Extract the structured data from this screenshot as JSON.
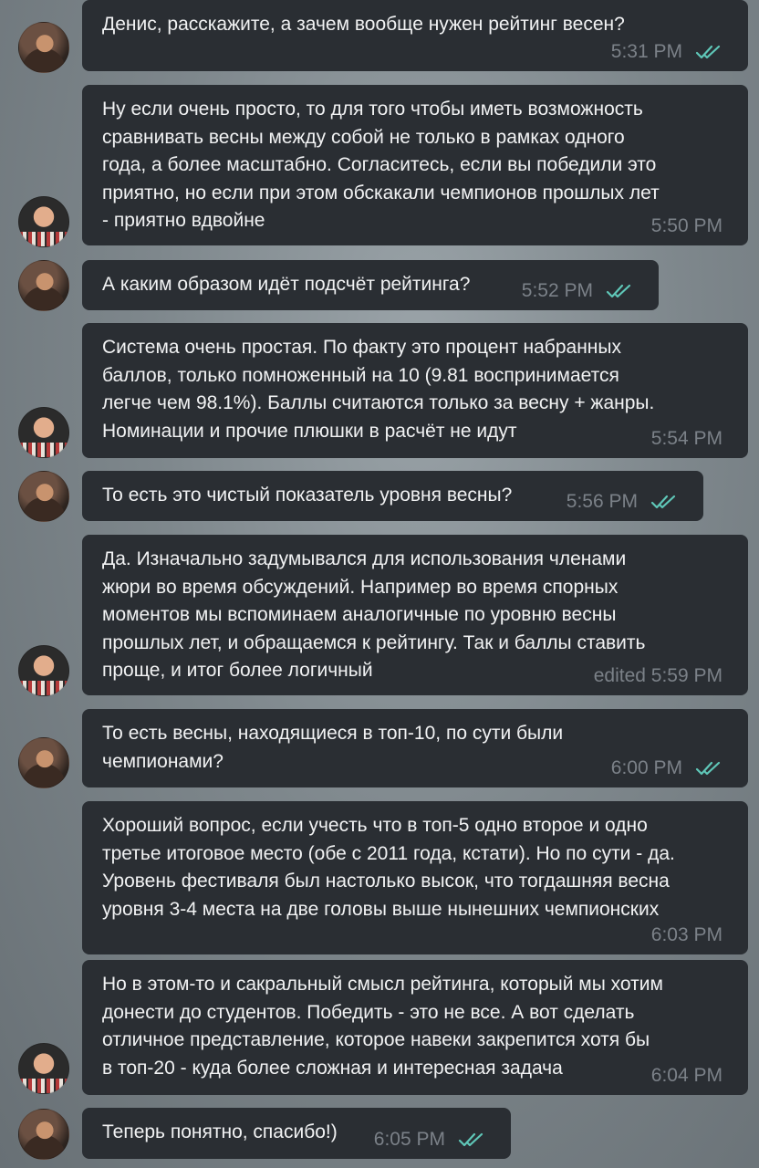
{
  "messages": [
    {
      "sender": "asker",
      "text": "Денис, расскажите, а зачем вообще нужен рейтинг весен?",
      "time": "5:31 PM",
      "read_icon": "double-check-icon"
    },
    {
      "sender": "denis",
      "text": "Ну если очень просто, то для того чтобы иметь возможность\nсравнивать весны между собой не только в рамках одного\nгода, а более масштабно. Согласитесь, если вы победили это\nприятно, но если при этом обскакали чемпионов прошлых лет\n- приятно вдвойне",
      "time": "5:50 PM"
    },
    {
      "sender": "asker",
      "text": "А каким образом идёт подсчёт рейтинга?",
      "time": "5:52 PM",
      "read_icon": "double-check-icon"
    },
    {
      "sender": "denis",
      "text": "Система очень простая. По факту это процент набранных\nбаллов, только помноженный на 10 (9.81 воспринимается\nлегче чем 98.1%). Баллы считаются только за весну + жанры.\nНоминации и прочие плюшки в расчёт не идут",
      "time": "5:54 PM"
    },
    {
      "sender": "asker",
      "text": "То есть это чистый показатель уровня весны?",
      "time": "5:56 PM",
      "read_icon": "double-check-icon"
    },
    {
      "sender": "denis",
      "text": "Да. Изначально задумывался для использования членами\nжюри во время обсуждений. Например во время спорных\nмоментов мы вспоминаем аналогичные по уровню весны\nпрошлых лет, и обращаемся к рейтингу. Так и баллы ставить\nпроще, и итог более логичный",
      "time": "edited 5:59 PM"
    },
    {
      "sender": "asker",
      "text": "То есть весны, находящиеся в топ-10, по сути были\nчемпионами?",
      "time": "6:00 PM",
      "read_icon": "double-check-icon"
    },
    {
      "sender": "denis",
      "text": "Хороший вопрос, если учесть что в топ-5 одно второе и одно\nтретье итоговое место (обе с 2011 года, кстати). Но по сути - да.\nУровень фестиваля был настолько высок, что тогдашняя весна\nуровня 3-4 места на две головы выше нынешних чемпионских",
      "time": "6:03 PM"
    },
    {
      "sender": "denis",
      "text": "Но в этом-то и сакральный смысл рейтинга, который мы хотим\nдонести до студентов. Победить - это не все. А вот сделать\nотличное представление, которое навеки закрепится хотя бы\nв топ-20 - куда более сложная и интересная задача",
      "time": "6:04 PM"
    },
    {
      "sender": "asker",
      "text": "Теперь понятно, спасибо!)",
      "time": "6:05 PM",
      "read_icon": "double-check-icon"
    }
  ],
  "colors": {
    "bubble": "#2a2e33",
    "text": "#f1f2f3",
    "meta": "#7b8188",
    "check": "#5fc7b8"
  }
}
